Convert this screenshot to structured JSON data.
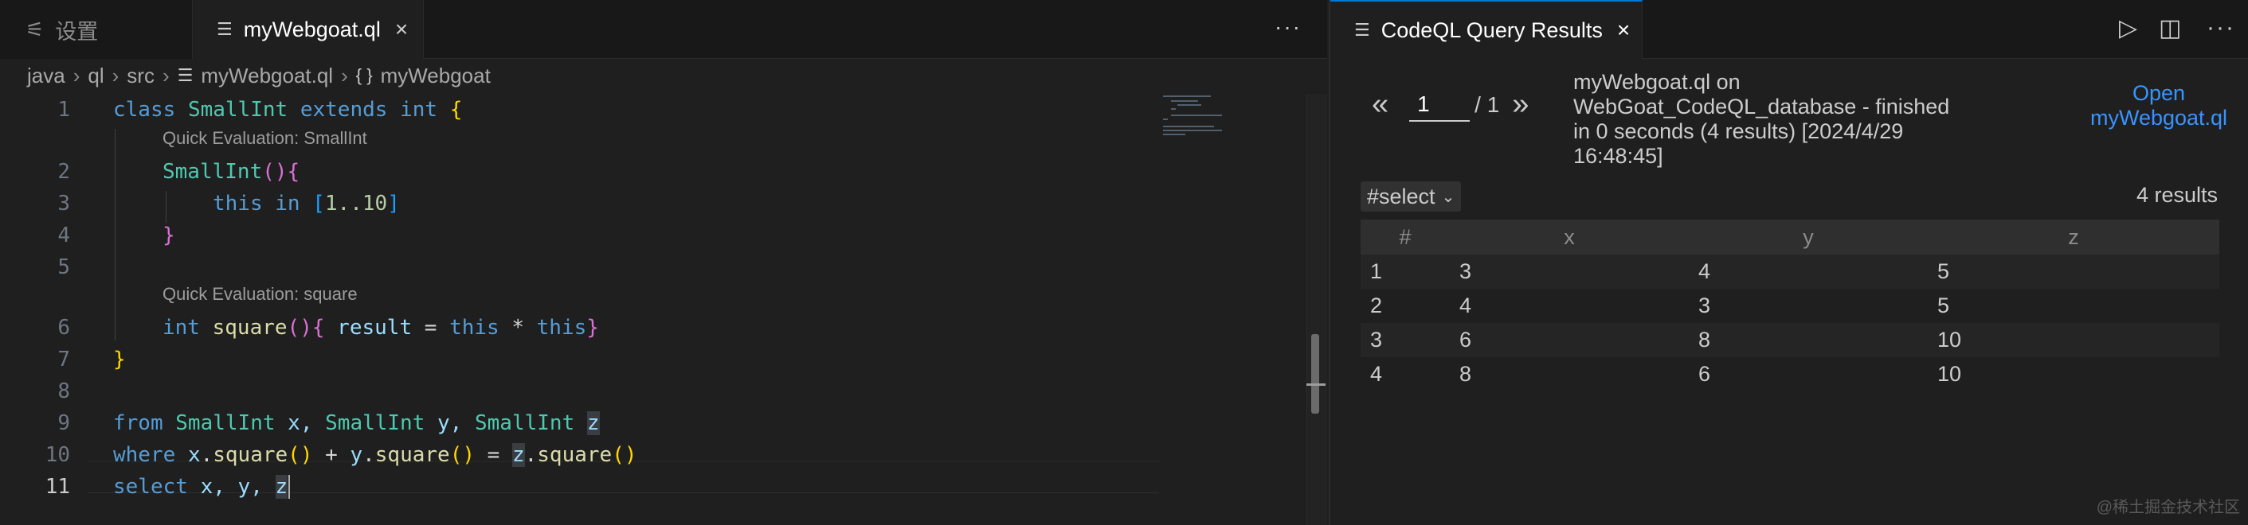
{
  "left_tabs": [
    {
      "label": "设置",
      "icon": "settings-sliders-icon"
    },
    {
      "label": "myWebgoat.ql",
      "icon": "file-lines-icon"
    }
  ],
  "breadcrumb": [
    "java",
    "ql",
    "src",
    "myWebgoat.ql",
    "myWebgoat"
  ],
  "editor": {
    "line_numbers": [
      "1",
      "2",
      "3",
      "4",
      "5",
      "6",
      "7",
      "8",
      "9",
      "10",
      "11"
    ],
    "code_lens": [
      "Quick Evaluation: SmallInt",
      "Quick Evaluation: square"
    ],
    "lines": [
      [
        "class",
        " ",
        "SmallInt",
        " ",
        "extends",
        " ",
        "int",
        " ",
        "{"
      ],
      [
        "SmallInt",
        "()",
        "{"
      ],
      [
        "this",
        " ",
        "in",
        " ",
        "[",
        "1..10",
        "]"
      ],
      [
        "}"
      ],
      [],
      [
        "int",
        " ",
        "square",
        "()",
        "{",
        " ",
        "result",
        " = ",
        "this",
        " * ",
        "this",
        "}"
      ],
      [
        "}"
      ],
      [],
      [
        "from",
        " ",
        "SmallInt",
        " x, ",
        "SmallInt",
        " y, ",
        "SmallInt",
        " ",
        "z"
      ],
      [
        "where",
        " ",
        "x",
        ".",
        "square",
        "()",
        " + ",
        "y",
        ".",
        "square",
        "()",
        " = ",
        "z",
        ".",
        "square",
        "()"
      ],
      [
        "select",
        " x, y, ",
        "z"
      ]
    ]
  },
  "results": {
    "tab_label": "CodeQL Query Results",
    "page_current": "1",
    "page_total": "/ 1",
    "prev_symbol": "«",
    "next_symbol": "»",
    "status": "myWebgoat.ql on WebGoat_CodeQL_database - finished in 0 seconds (4 results) [2024/4/29 16:48:45]",
    "open_link": "Open myWebgoat.ql",
    "result_set": "#select",
    "result_count": "4 results",
    "columns": [
      "#",
      "x",
      "y",
      "z"
    ],
    "rows": [
      [
        "1",
        "3",
        "4",
        "5"
      ],
      [
        "2",
        "4",
        "3",
        "5"
      ],
      [
        "3",
        "6",
        "8",
        "10"
      ],
      [
        "4",
        "8",
        "6",
        "10"
      ]
    ]
  },
  "watermark": "@稀土掘金技术社区",
  "colors": {
    "accent": "#0078d4",
    "link": "#3794ff",
    "keyword": "#569cd6",
    "type": "#4ec9b0",
    "function": "#dcdcaa"
  }
}
